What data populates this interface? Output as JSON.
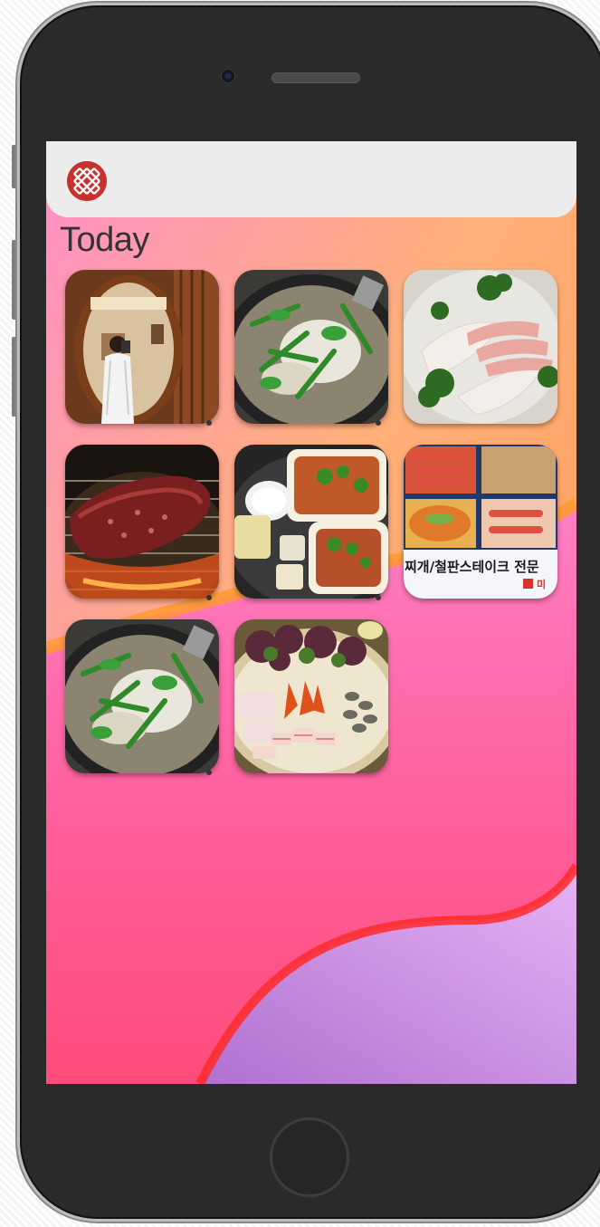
{
  "app": {
    "logo_icon": "lattice-logo-icon",
    "brand_color": "#c8322e"
  },
  "section": {
    "title": "Today"
  },
  "photos": [
    {
      "id": "photo-1",
      "subject": "mirror-selfie-photo"
    },
    {
      "id": "photo-2",
      "subject": "fish-soup-photo"
    },
    {
      "id": "photo-3",
      "subject": "sashimi-platter-photo"
    },
    {
      "id": "photo-4",
      "subject": "grilled-steak-photo"
    },
    {
      "id": "photo-5",
      "subject": "takeout-spicy-dishes-photo"
    },
    {
      "id": "photo-6",
      "subject": "restaurant-menu-sign-photo",
      "sign_line": "찌개/철판스테이크 전문",
      "sign_sub": "미"
    },
    {
      "id": "photo-7",
      "subject": "fish-soup-photo"
    },
    {
      "id": "photo-8",
      "subject": "bossam-platter-photo"
    }
  ],
  "colors": {
    "bg_pink": "#ff6fa9",
    "bg_orange": "#ffa04a",
    "bg_red": "#ff2a2a",
    "bg_lavender": "#d9a3f0",
    "topbar": "#ececec",
    "phone_body": "#2a2a2a"
  }
}
